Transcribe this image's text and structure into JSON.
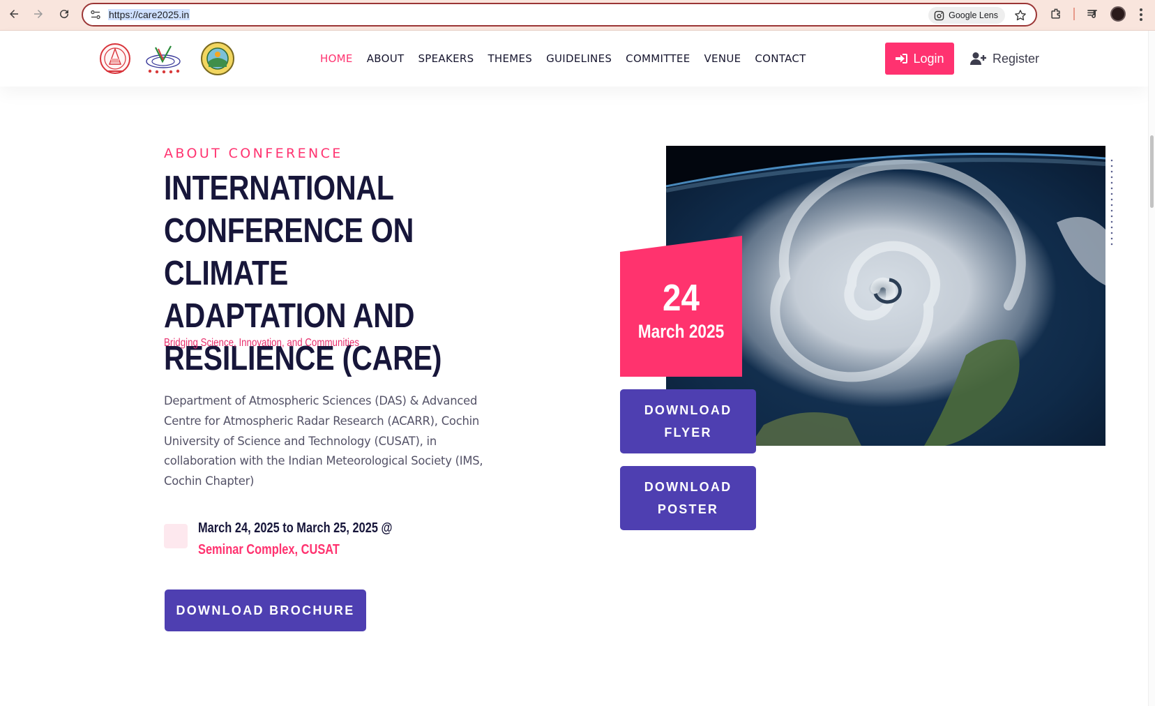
{
  "browser": {
    "url": "https://care2025.in",
    "lens_label": "Google Lens"
  },
  "header": {
    "logos": [
      "cusat-logo",
      "acarr-logo",
      "ims-logo"
    ],
    "nav": [
      {
        "label": "HOME",
        "active": true
      },
      {
        "label": "ABOUT",
        "active": false
      },
      {
        "label": "SPEAKERS",
        "active": false
      },
      {
        "label": "THEMES",
        "active": false
      },
      {
        "label": "GUIDELINES",
        "active": false
      },
      {
        "label": "COMMITTEE",
        "active": false
      },
      {
        "label": "VENUE",
        "active": false
      },
      {
        "label": "CONTACT",
        "active": false
      }
    ],
    "login_label": "Login",
    "register_label": "Register"
  },
  "hero": {
    "eyebrow": "ABOUT CONFERENCE",
    "title": "INTERNATIONAL CONFERENCE ON CLIMATE ADAPTATION AND RESILIENCE (CARE)",
    "tagline": "Bridging Science, Innovation, and Communities",
    "description": "Department of Atmospheric Sciences (DAS) & Advanced Centre for Atmospheric Radar Research (ACARR), Cochin University of Science and Technology (CUSAT), in collaboration with the Indian Meteorological Society (IMS, Cochin Chapter)",
    "event_dates": "March 24, 2025 to March 25, 2025 @ ",
    "event_venue": "Seminar Complex, CUSAT",
    "brochure_button": "DOWNLOAD BROCHURE",
    "date_card": {
      "day": "24",
      "month_year": "March 2025"
    },
    "flyer_button": "DOWNLOAD FLYER",
    "poster_button": "DOWNLOAD POSTER"
  },
  "colors": {
    "accent_pink": "#ff3370",
    "button_purple": "#4e3fb1",
    "heading_navy": "#17163a",
    "chrome_bg": "#f9e5dd"
  },
  "icons": [
    "back-icon",
    "forward-icon",
    "reload-icon",
    "site-settings-icon",
    "lens-icon",
    "star-icon",
    "extensions-icon",
    "media-icon",
    "sign-in-icon",
    "user-plus-icon",
    "calendar-icon"
  ]
}
